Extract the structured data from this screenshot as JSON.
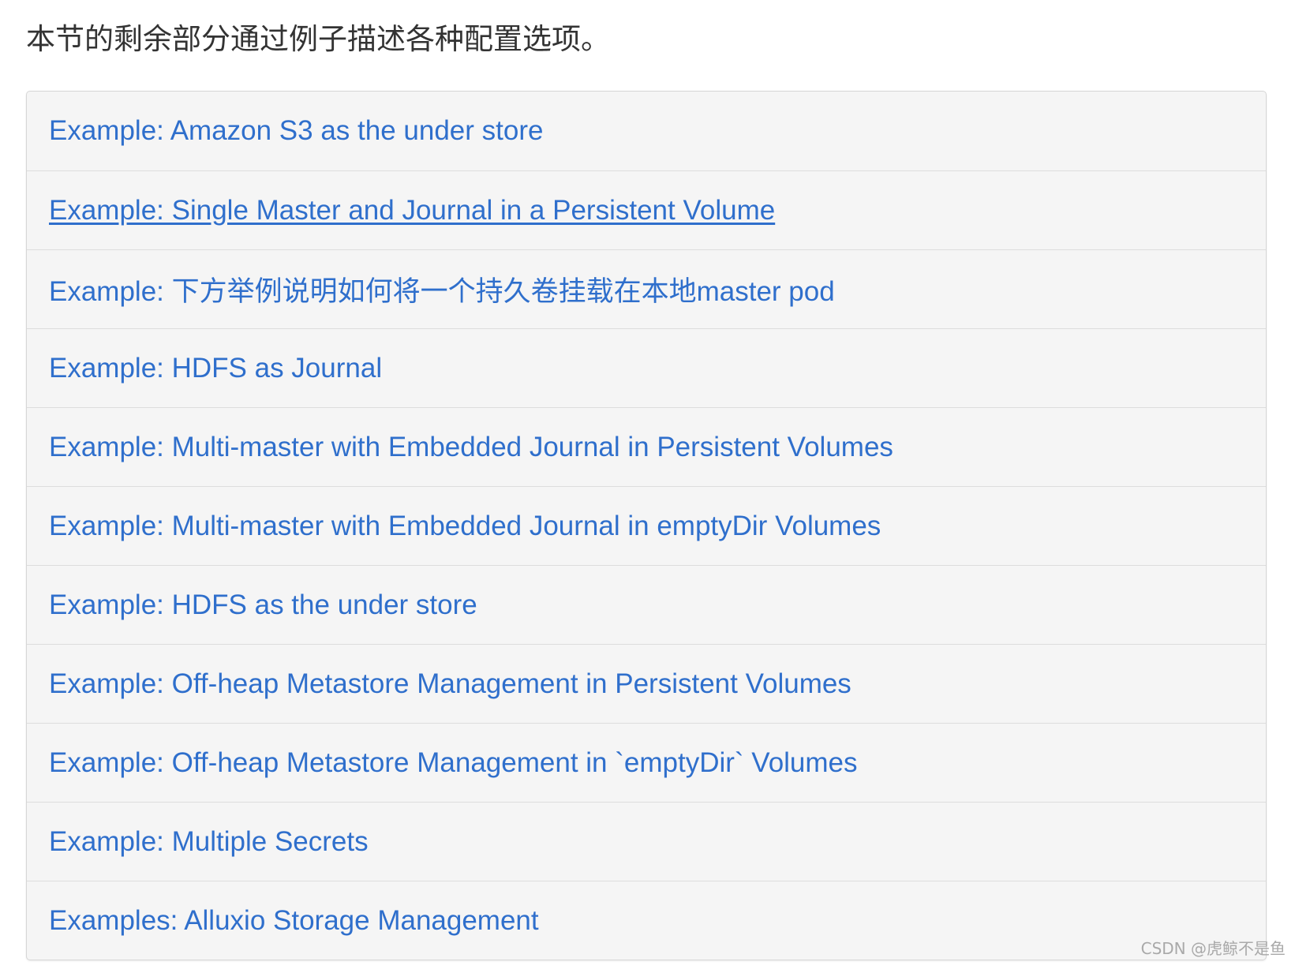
{
  "intro_text": "本节的剩余部分通过例子描述各种配置选项。",
  "examples": [
    "Example: Amazon S3 as the under store",
    "Example: Single Master and Journal in a Persistent Volume",
    "Example: 下方举例说明如何将一个持久卷挂载在本地master pod",
    "Example: HDFS as Journal",
    "Example: Multi-master with Embedded Journal in Persistent Volumes",
    "Example: Multi-master with Embedded Journal in emptyDir Volumes",
    "Example: HDFS as the under store",
    "Example: Off-heap Metastore Management in Persistent Volumes",
    "Example: Off-heap Metastore Management in `emptyDir` Volumes",
    "Example: Multiple Secrets",
    "Examples: Alluxio Storage Management"
  ],
  "watermark": "CSDN @虎鲸不是鱼",
  "colors": {
    "link": "#2f6fcc",
    "list_background": "#f5f5f5",
    "border": "#d6d6d6",
    "intro_text": "#333333"
  }
}
